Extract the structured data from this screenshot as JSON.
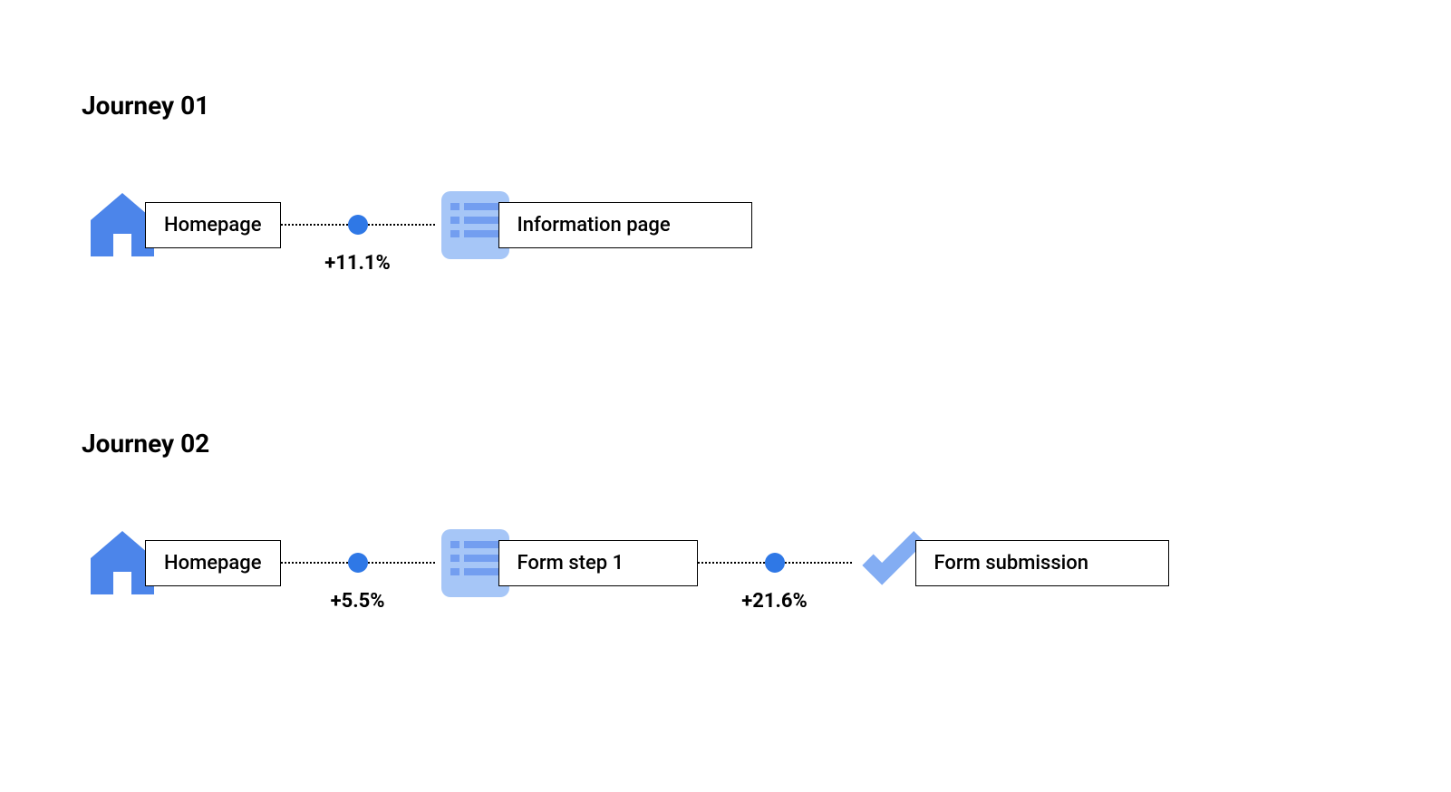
{
  "colors": {
    "home_icon": "#4c85ea",
    "list_bg": "#a6c6f7",
    "list_lines": "#739ef0",
    "check_icon": "#83adf3",
    "dot": "#2f78e6"
  },
  "journeys": [
    {
      "title": "Journey 01",
      "steps": [
        {
          "icon": "home",
          "label": "Homepage"
        },
        {
          "icon": "list",
          "label": "Information page"
        }
      ],
      "connectors": [
        {
          "change": "+11.1%"
        }
      ]
    },
    {
      "title": "Journey 02",
      "steps": [
        {
          "icon": "home",
          "label": "Homepage"
        },
        {
          "icon": "list",
          "label": "Form step 1"
        },
        {
          "icon": "check",
          "label": "Form submission"
        }
      ],
      "connectors": [
        {
          "change": "+5.5%"
        },
        {
          "change": "+21.6%"
        }
      ]
    }
  ]
}
